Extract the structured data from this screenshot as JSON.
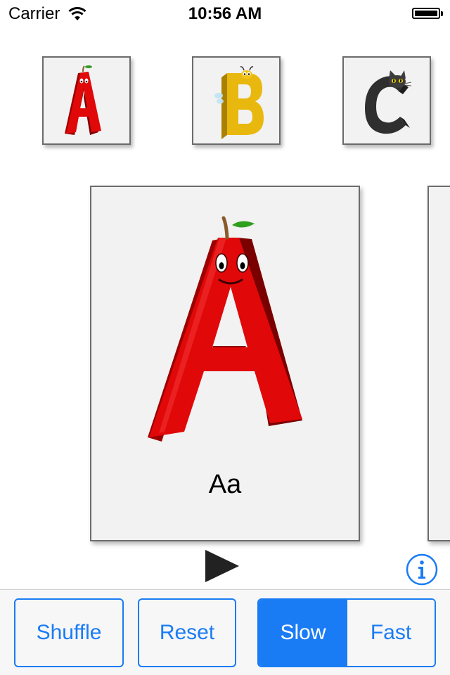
{
  "status_bar": {
    "carrier": "Carrier",
    "time": "10:56 AM",
    "wifi_icon": "wifi-icon",
    "battery_icon": "battery-icon",
    "battery_level": 1.0
  },
  "thumbnails": [
    {
      "letter": "A",
      "character": "apple",
      "color": "#e00808"
    },
    {
      "letter": "B",
      "character": "bee",
      "color": "#e8b80e"
    },
    {
      "letter": "C",
      "character": "cat",
      "color": "#3c3c3c"
    }
  ],
  "card": {
    "letter": "A",
    "character": "apple",
    "caption": "Aa"
  },
  "controls": {
    "play_icon": "play-icon",
    "info_icon": "info-icon"
  },
  "toolbar": {
    "shuffle_label": "Shuffle",
    "reset_label": "Reset",
    "speed_options": [
      "Slow",
      "Fast"
    ],
    "speed_selected": "Slow"
  },
  "colors": {
    "accent": "#1a7cf5",
    "card_bg": "#f2f2f2",
    "toolbar_bg": "#f7f7f7"
  }
}
